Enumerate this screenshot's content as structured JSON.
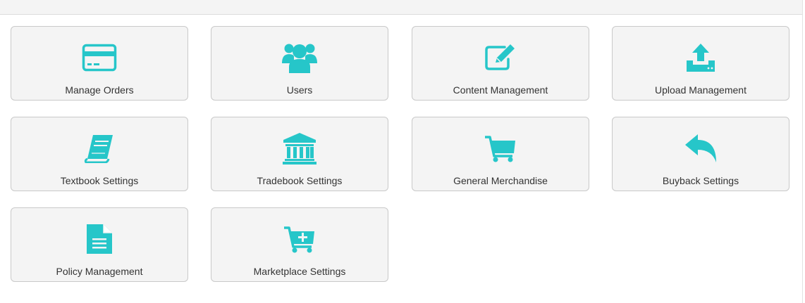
{
  "theme": {
    "icon_color": "#26c6c9",
    "tile_background": "#f4f4f4",
    "tile_border": "#c9c9c9",
    "label_color": "#333333"
  },
  "tiles": [
    {
      "label": "Manage Orders",
      "icon": "credit-card-icon"
    },
    {
      "label": "Users",
      "icon": "users-icon"
    },
    {
      "label": "Content Management",
      "icon": "edit-icon"
    },
    {
      "label": "Upload Management",
      "icon": "upload-icon"
    },
    {
      "label": "Textbook Settings",
      "icon": "book-icon"
    },
    {
      "label": "Tradebook Settings",
      "icon": "bank-icon"
    },
    {
      "label": "General Merchandise",
      "icon": "cart-icon"
    },
    {
      "label": "Buyback Settings",
      "icon": "reply-icon"
    },
    {
      "label": "Policy Management",
      "icon": "document-icon"
    },
    {
      "label": "Marketplace Settings",
      "icon": "cart-plus-icon"
    }
  ]
}
